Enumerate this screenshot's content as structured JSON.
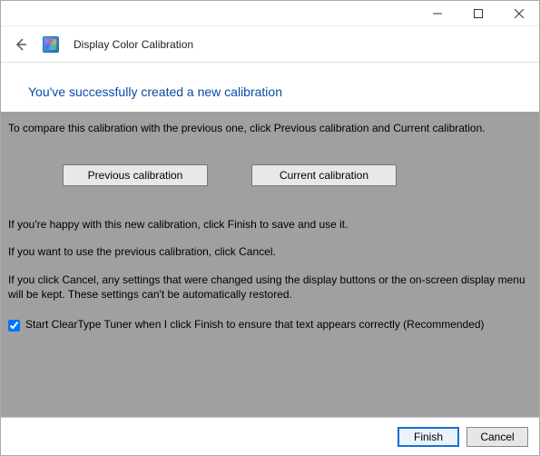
{
  "titlebar": {
    "minimize": "Minimize",
    "maximize": "Maximize",
    "close": "Close"
  },
  "header": {
    "back": "Back",
    "title": "Display Color Calibration"
  },
  "heading": "You've successfully created a new calibration",
  "body": {
    "compare_intro": "To compare this calibration with the previous one, click Previous calibration and Current calibration.",
    "prev_btn": "Previous calibration",
    "curr_btn": "Current calibration",
    "happy": "If you're happy with this new calibration, click Finish to save and use it.",
    "use_prev": "If you want to use the previous calibration, click Cancel.",
    "cancel_note": "If you click Cancel, any settings that were changed using the display buttons or the on-screen display menu will be kept. These settings can't be automatically restored.",
    "cleartype": "Start ClearType Tuner when I click Finish to ensure that text appears correctly (Recommended)"
  },
  "footer": {
    "finish": "Finish",
    "cancel": "Cancel"
  }
}
